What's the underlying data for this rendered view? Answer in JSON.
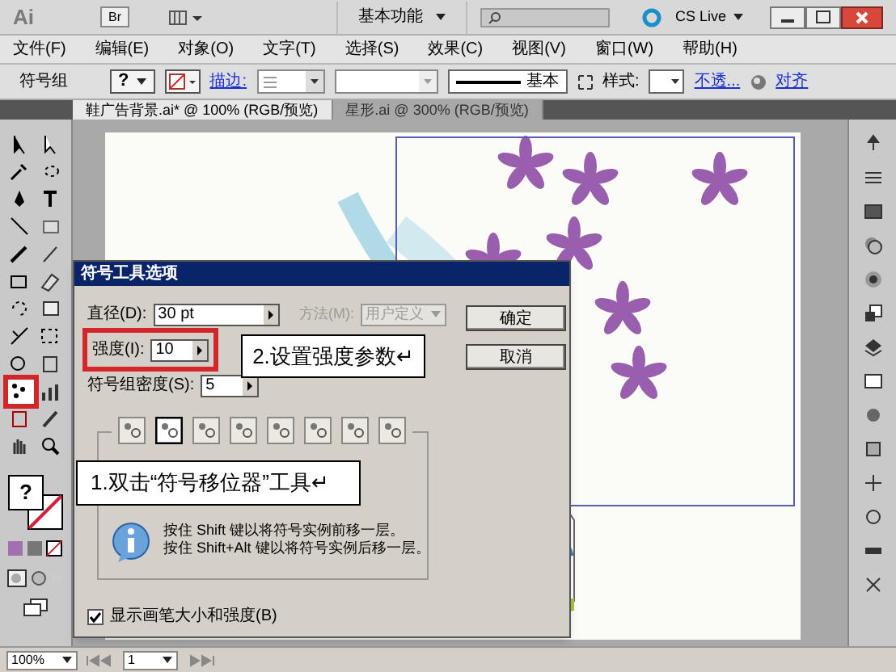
{
  "app": {
    "logo": "Ai",
    "bridge": "Br",
    "workspace": "基本功能",
    "cs_live": "CS Live"
  },
  "menu": [
    "文件(F)",
    "编辑(E)",
    "对象(O)",
    "文字(T)",
    "选择(S)",
    "效果(C)",
    "视图(V)",
    "窗口(W)",
    "帮助(H)"
  ],
  "control_bar": {
    "label": "符号组",
    "fill": "?",
    "stroke_link": "描边:",
    "stroke_style": "基本",
    "style_label": "样式:",
    "opacity_link": "不透...",
    "align_link": "对齐"
  },
  "tabs": [
    {
      "label": "鞋广告背景.ai* @ 100% (RGB/预览)",
      "selected": true
    },
    {
      "label": "星形.ai @ 300% (RGB/预览)",
      "selected": false
    }
  ],
  "toolbar": {
    "tools": [
      {
        "selected": false
      },
      {
        "selected": false
      },
      {
        "selected": false
      },
      {
        "selected": false
      },
      {
        "selected": false
      },
      {
        "selected": false
      },
      {
        "selected": false
      },
      {
        "selected": false
      },
      {
        "selected": false
      },
      {
        "selected": false
      },
      {
        "selected": false
      },
      {
        "selected": false
      },
      {
        "selected": false
      },
      {
        "selected": false
      },
      {
        "selected": false
      },
      {
        "selected": false
      },
      {
        "selected": false
      },
      {
        "selected": false
      },
      {
        "selected": true
      },
      {
        "selected": false
      },
      {
        "selected": false
      },
      {
        "selected": false
      },
      {
        "selected": false
      },
      {
        "selected": false
      }
    ],
    "fill_swatch": "?"
  },
  "dialog": {
    "title": "符号工具选项",
    "diameter": {
      "label": "直径(D):",
      "value": "30 pt"
    },
    "method": {
      "label": "方法(M):",
      "value": "用户定义",
      "disabled": true
    },
    "intensity": {
      "label": "强度(I):",
      "value": "10"
    },
    "density": {
      "label": "符号组密度(S):",
      "value": "5"
    },
    "symbol_tools": [
      {
        "selected": false
      },
      {
        "selected": true
      },
      {
        "selected": false
      },
      {
        "selected": false
      },
      {
        "selected": false
      },
      {
        "selected": false
      },
      {
        "selected": false
      },
      {
        "selected": false
      }
    ],
    "info": [
      "按住 Shift 键以将符号实例前移一层。",
      "按住 Shift+Alt 键以将符号实例后移一层。"
    ],
    "show_brush": {
      "label": "显示画笔大小和强度(B)",
      "checked": true
    },
    "buttons": [
      "确定",
      "取消"
    ]
  },
  "annotations": [
    "2.设置强度参数↵",
    "1.双击“符号移位器”工具↵"
  ],
  "status_bar": {
    "zoom": "100%",
    "page": "1"
  }
}
